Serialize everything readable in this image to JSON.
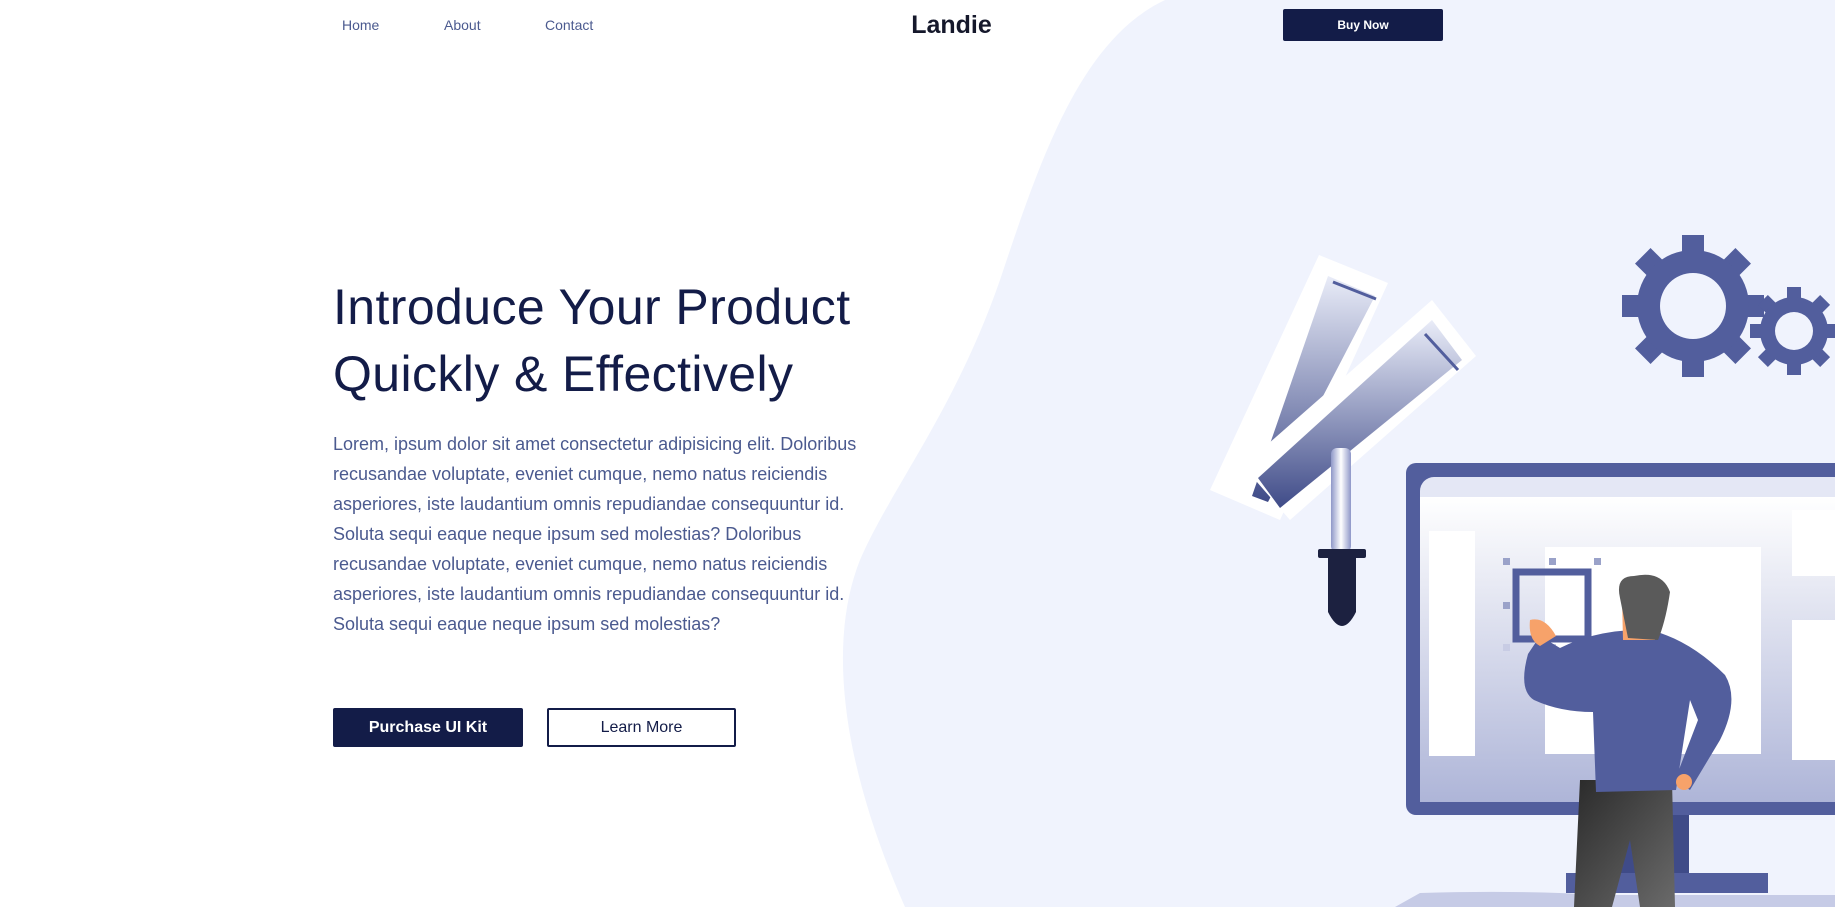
{
  "nav": {
    "links": [
      "Home",
      "About",
      "Contact"
    ],
    "brand": "Landie",
    "cta": "Buy Now"
  },
  "hero": {
    "title_line1": "Introduce Your Product",
    "title_line2": "Quickly & Effectively",
    "body": "Lorem, ipsum dolor sit amet consectetur adipisicing elit. Doloribus recusandae voluptate, eveniet cumque, nemo natus reiciendis asperiores, iste laudantium omnis repudiandae consequuntur id. Soluta sequi eaque neque ipsum sed molestias? Doloribus recusandae voluptate, eveniet cumque, nemo natus reiciendis asperiores, iste laudantium omnis repudiandae consequuntur id. Soluta sequi eaque neque ipsum sed molestias?",
    "primary_button": "Purchase UI Kit",
    "secondary_button": "Learn More"
  },
  "colors": {
    "navy": "#131c48",
    "muted_blue": "#4b5a8f",
    "blob": "#f0f3fd",
    "accent": "#525e9d"
  },
  "illustration": {
    "icons": [
      "color-swatch-icon",
      "gear-icon",
      "monitor-icon",
      "person-icon"
    ]
  }
}
